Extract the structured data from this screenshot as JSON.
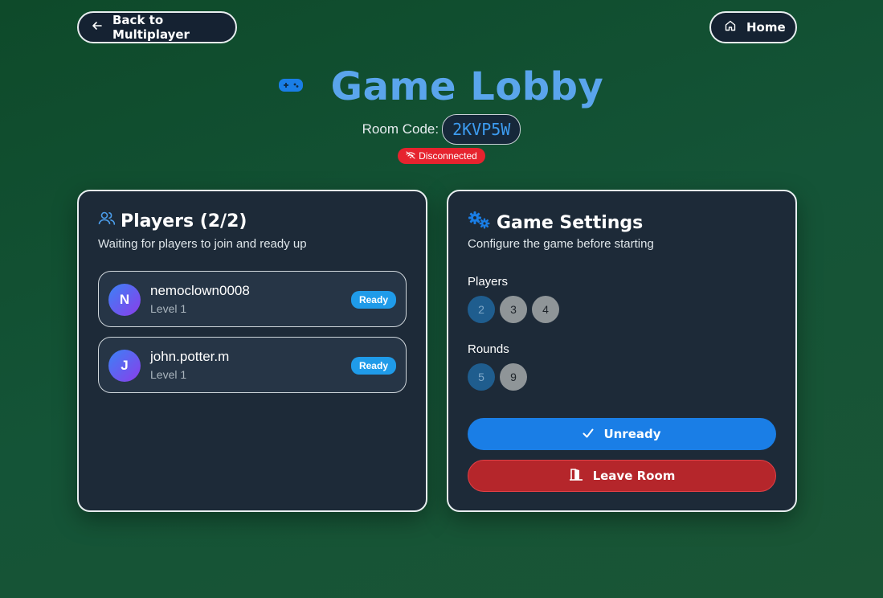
{
  "nav": {
    "back_label": "Back to Multiplayer",
    "home_label": "Home"
  },
  "header": {
    "title": "Game Lobby",
    "room_code_label": "Room Code:",
    "room_code": "2KVP5W",
    "status": "Disconnected"
  },
  "players_panel": {
    "title": "Players (2/2)",
    "subtitle": "Waiting for players to join and ready up",
    "players": [
      {
        "initial": "N",
        "name": "nemoclown0008",
        "level": "Level 1",
        "status": "Ready"
      },
      {
        "initial": "J",
        "name": "john.potter.m",
        "level": "Level 1",
        "status": "Ready"
      }
    ]
  },
  "settings_panel": {
    "title": "Game Settings",
    "subtitle": "Configure the game before starting",
    "players_label": "Players",
    "player_options": [
      "2",
      "3",
      "4"
    ],
    "player_selected": "2",
    "rounds_label": "Rounds",
    "round_options": [
      "5",
      "9"
    ],
    "round_selected": "5",
    "unready_label": "Unready",
    "leave_label": "Leave Room"
  },
  "colors": {
    "accent": "#1a7ee6",
    "title": "#5aa5ec",
    "danger": "#b5262b",
    "status_disconnected": "#e6232e",
    "ready": "#1f9be9"
  },
  "icons": {
    "back": "arrow-left-icon",
    "home": "house-icon",
    "title": "gamepad-icon",
    "status": "wifi-off-icon",
    "players": "users-icon",
    "settings": "gears-icon",
    "unready": "check-icon",
    "leave": "door-icon"
  }
}
